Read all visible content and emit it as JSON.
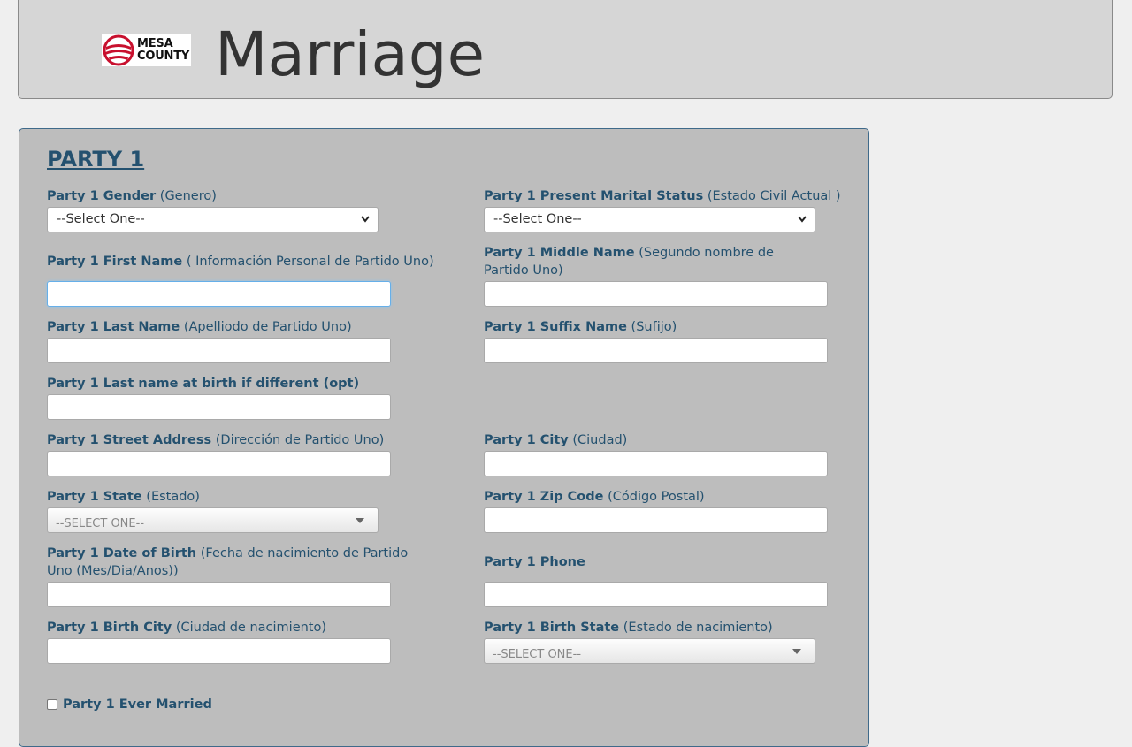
{
  "header": {
    "logo_line1": "MESA",
    "logo_line2": "COUNTY",
    "title": "Marriage"
  },
  "section": {
    "title": "PARTY 1"
  },
  "fields": {
    "gender": {
      "label": "Party 1 Gender",
      "hint": " (Genero)",
      "selected": "--Select One--"
    },
    "marital_status": {
      "label": "Party 1 Present Marital Status",
      "hint": " (Estado Civil Actual )",
      "selected": "--Select One--"
    },
    "first_name": {
      "label": "Party 1 First Name",
      "hint": " ( Información Personal de Partido Uno)",
      "value": ""
    },
    "middle_name": {
      "label": "Party 1 Middle Name",
      "hint": " (Segundo nombre de Partido Uno)",
      "value": ""
    },
    "last_name": {
      "label": "Party 1 Last Name",
      "hint": " (Apelliodo de Partido Uno)",
      "value": ""
    },
    "suffix_name": {
      "label": "Party 1 Suffix Name",
      "hint": " (Sufijo)",
      "value": ""
    },
    "birth_last_name": {
      "label": "Party 1 Last name at birth if different (opt)",
      "value": ""
    },
    "street_address": {
      "label": "Party 1 Street Address",
      "hint": " (Dirección de Partido Uno)",
      "value": ""
    },
    "city": {
      "label": "Party 1 City",
      "hint": " (Ciudad)",
      "value": ""
    },
    "state": {
      "label": "Party 1 State",
      "hint": " (Estado)",
      "selected": "--SELECT ONE--"
    },
    "zip": {
      "label": "Party 1 Zip Code",
      "hint": " (Código Postal)",
      "value": ""
    },
    "dob": {
      "label": "Party 1 Date of Birth",
      "hint": " (Fecha de nacimiento de Partido Uno (Mes/Dia/Anos))",
      "value": ""
    },
    "phone": {
      "label": "Party 1 Phone",
      "value": ""
    },
    "birth_city": {
      "label": "Party 1 Birth City",
      "hint": " (Ciudad de nacimiento)",
      "value": ""
    },
    "birth_state": {
      "label": "Party 1 Birth State",
      "hint": " (Estado de nacimiento)",
      "selected": "--SELECT ONE--"
    },
    "ever_married": {
      "label": "Party 1 Ever Married",
      "checked": false
    }
  },
  "colors": {
    "label": "#24516f",
    "panel": "#bdbdbd",
    "header": "#d6d6d6",
    "logo_red": "#c8102e"
  },
  "icons": {
    "logo": "mesa-county-logo-icon",
    "select_caret": "chevron-down-icon",
    "chosen_arrow": "triangle-down-icon"
  }
}
